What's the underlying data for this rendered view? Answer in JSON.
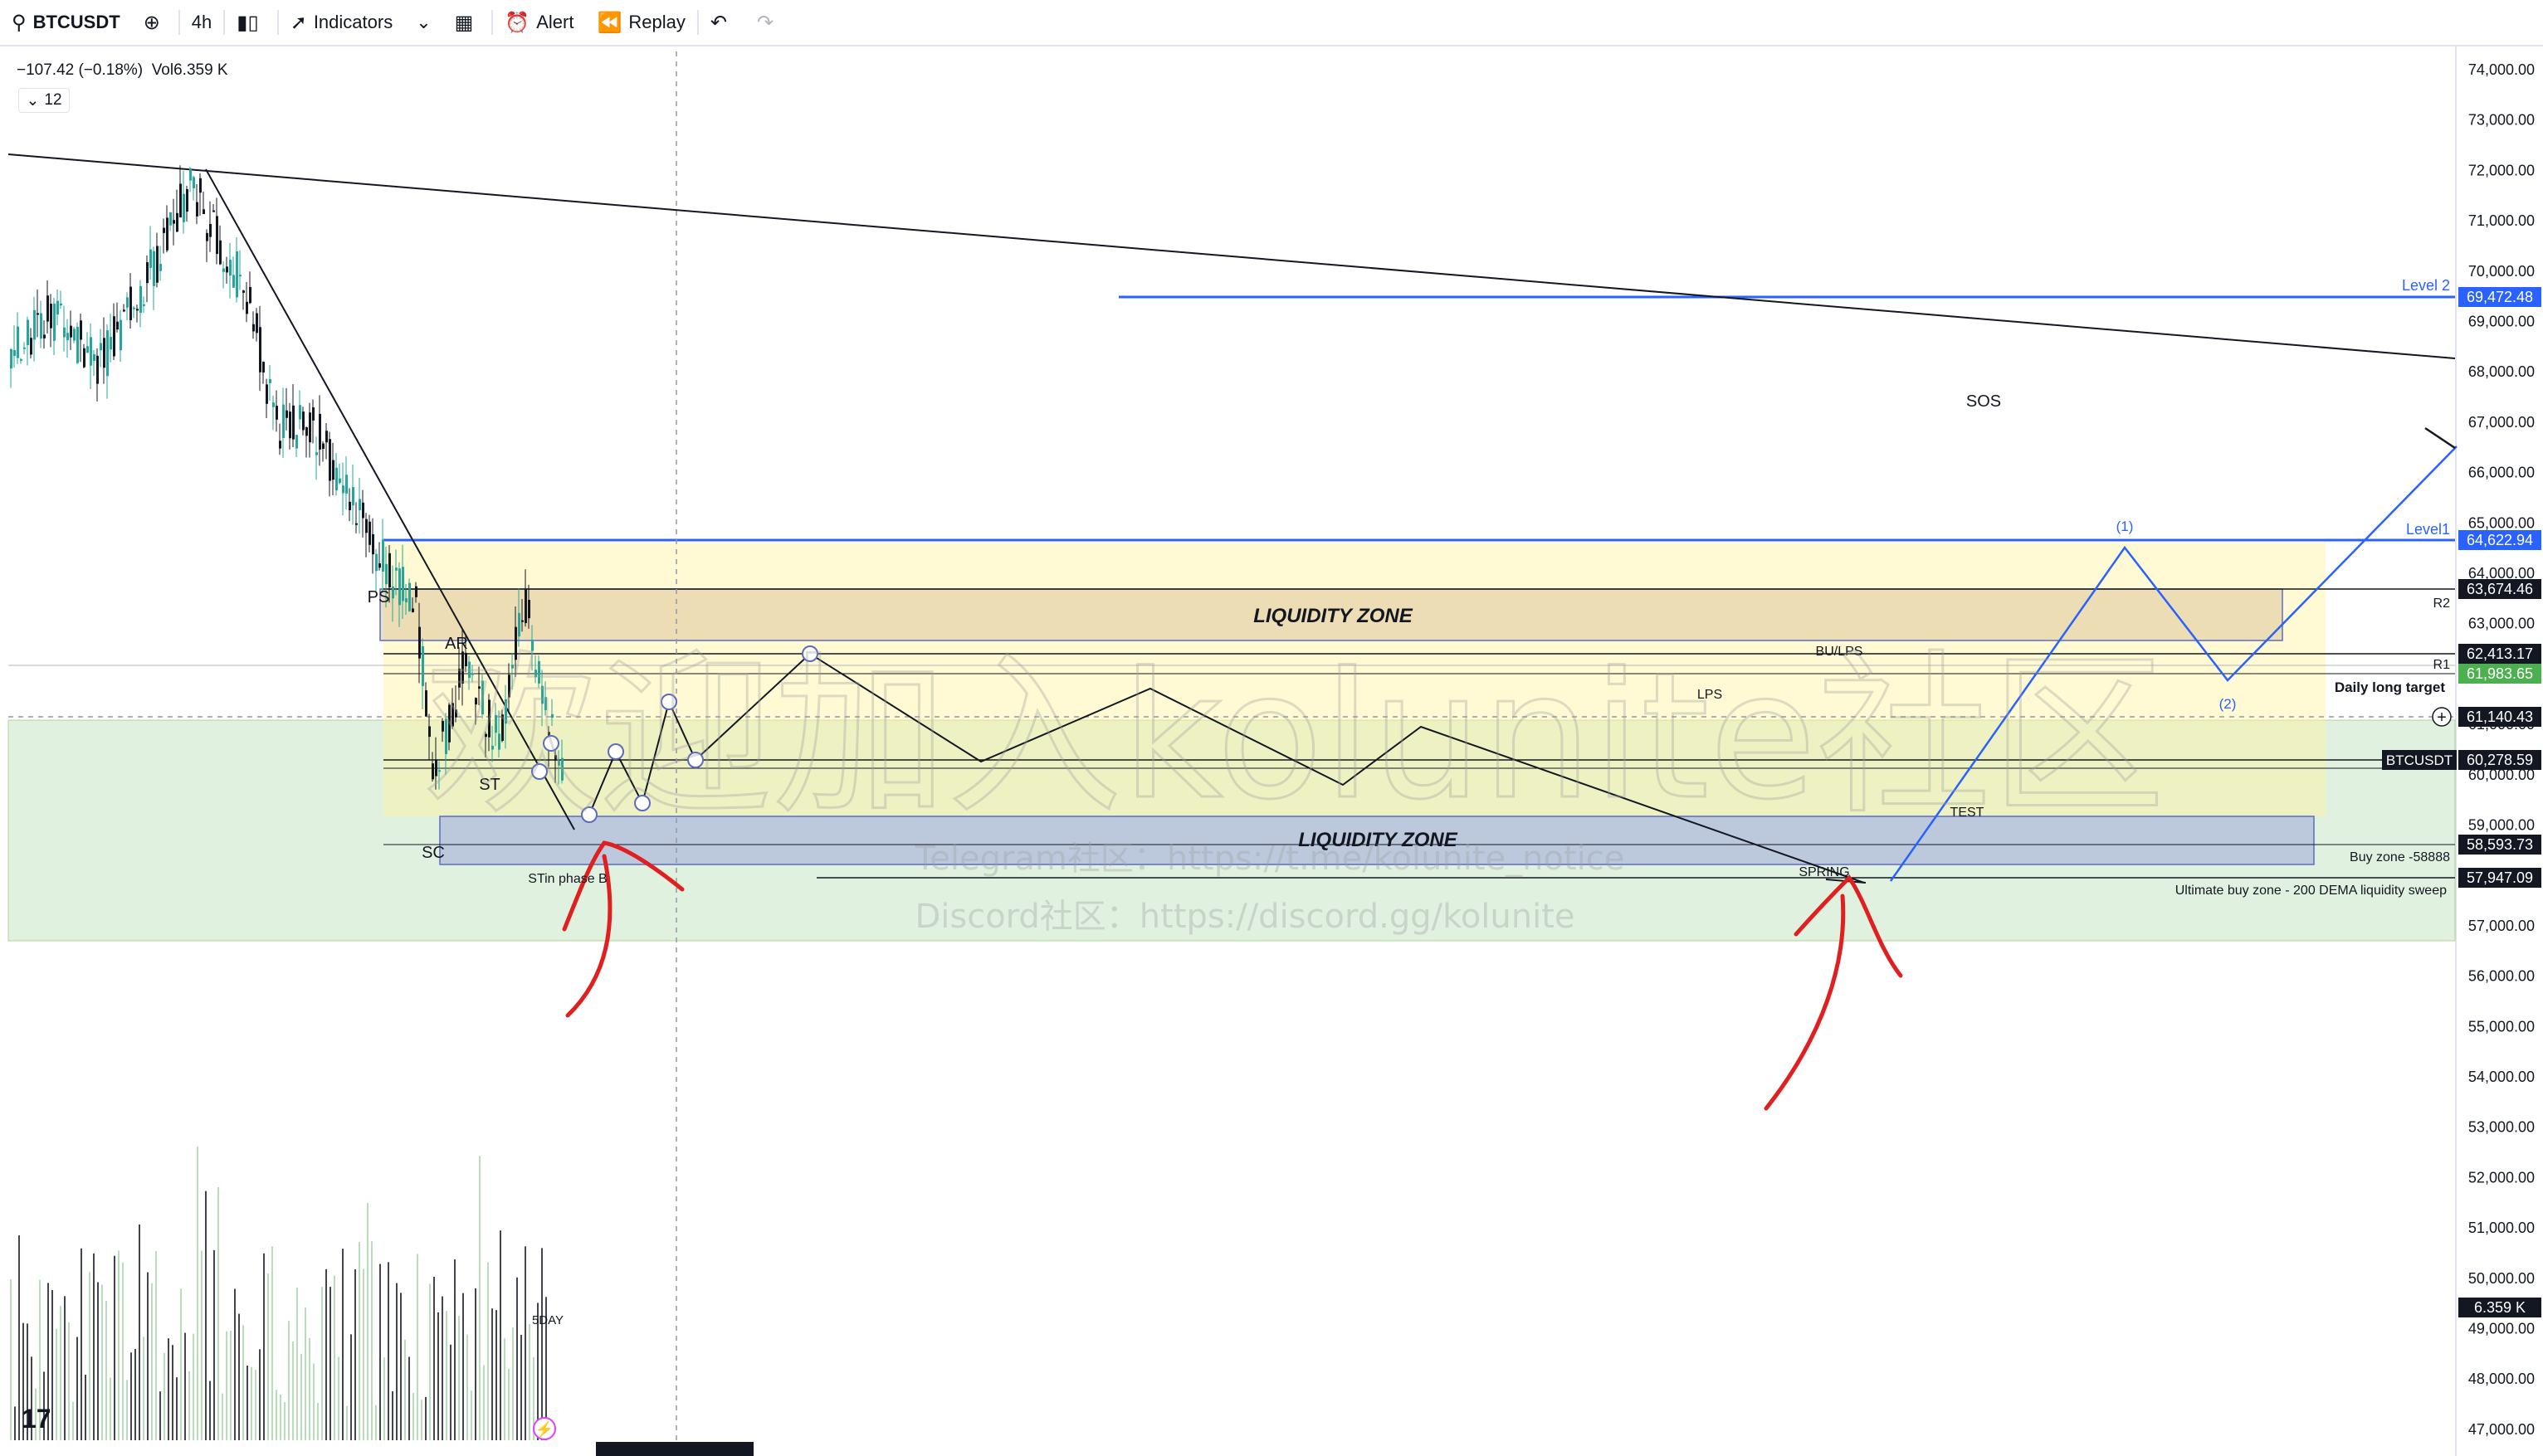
{
  "toolbar": {
    "symbol": "BTCUSDT",
    "interval": "4h",
    "indicators_label": "Indicators",
    "alert_label": "Alert",
    "replay_label": "Replay",
    "icons": [
      "search-icon",
      "add-symbol-icon",
      "candle-style-icon",
      "indicators-icon",
      "chevron-down-icon",
      "layout-grid-icon",
      "alert-clock-icon",
      "replay-icon",
      "undo-icon",
      "redo-icon"
    ]
  },
  "legend": {
    "change": "−107.42 (−0.18%)",
    "volume": "Vol6.359 K",
    "collapse_count": "12"
  },
  "price_axis": {
    "ticks": [
      "74,000.00",
      "73,000.00",
      "72,000.00",
      "71,000.00",
      "70,000.00",
      "69,000.00",
      "68,000.00",
      "67,000.00",
      "66,000.00",
      "65,000.00",
      "64,000.00",
      "63,000.00",
      "62,000.00",
      "61,000.00",
      "60,000.00",
      "59,000.00",
      "58,000.00",
      "57,000.00",
      "56,000.00",
      "55,000.00",
      "54,000.00",
      "53,000.00",
      "52,000.00",
      "51,000.00",
      "50,000.00",
      "49,000.00",
      "48,000.00",
      "47,000.00"
    ],
    "badges": {
      "level2": "69,472.48",
      "level1": "64,622.94",
      "r2": "63,674.46",
      "r1a": "62,413.17",
      "r1b": "61,983.65",
      "cursor": "61,140.43",
      "last": "60,278.59",
      "buy": "58,593.73",
      "ultimate": "57,947.09",
      "volume": "6.359 K"
    },
    "symbol_badge": "BTCUSDT"
  },
  "annotations": {
    "liquidity_zone_top": "LIQUIDITY ZONE",
    "liquidity_zone_bottom": "LIQUIDITY ZONE",
    "level2": "Level 2",
    "level1": "Level1",
    "r2": "R2",
    "r1": "R1",
    "daily_target": "Daily long target",
    "buy_zone": "Buy zone -58888",
    "ultimate_zone": "Ultimate buy zone - 200 DEMA liquidity sweep",
    "sos": "SOS",
    "wave1": "(1)",
    "wave2": "(2)",
    "bu_lps": "BU/LPS",
    "lps": "LPS",
    "test": "TEST",
    "spring": "SPRING",
    "ps": "PS",
    "ar": "AR",
    "st": "ST",
    "sc": "SC",
    "st_phase_b": "STin phase B",
    "volume_dates": "5DAY"
  },
  "watermark": {
    "main": "欢迎加入kolunite社区",
    "telegram": "Telegram社区：https://t.me/kolunite_notice",
    "discord": "Discord社区：https://discord.gg/kolunite"
  },
  "colors": {
    "accent_blue": "#2962ff",
    "liquidity_zone": "#c8a77a",
    "yellow_zone": "#fff59d",
    "green_zone": "#a5d6a7",
    "buy_zone": "#9fa8da",
    "marker_red": "#e02020",
    "candle_up": "#26a69a",
    "candle_down": "#131722"
  }
}
